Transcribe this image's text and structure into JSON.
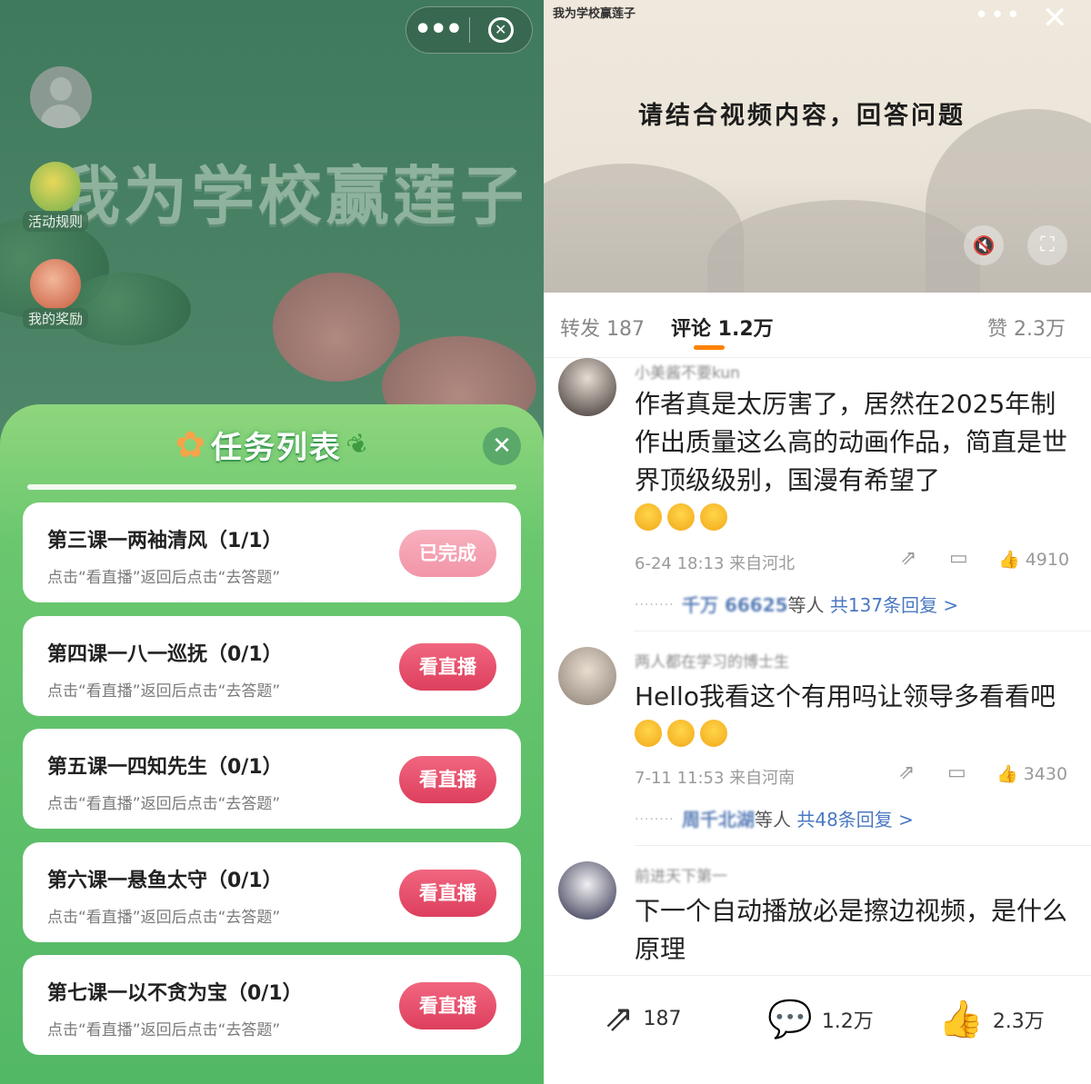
{
  "left": {
    "banner_title": "我为学校赢莲子",
    "side_buttons": [
      "活动规则",
      "我的奖励"
    ],
    "sheet": {
      "title": "任务列表",
      "tasks": [
        {
          "title": "第三课一两袖清风（1/1）",
          "hint": "点击“看直播”返回后点击“去答题”",
          "button": "已完成",
          "status": "done"
        },
        {
          "title": "第四课一八一巡抚（0/1）",
          "hint": "点击“看直播”返回后点击“去答题”",
          "button": "看直播",
          "status": "todo"
        },
        {
          "title": "第五课一四知先生（0/1）",
          "hint": "点击“看直播”返回后点击“去答题”",
          "button": "看直播",
          "status": "todo"
        },
        {
          "title": "第六课一悬鱼太守（0/1）",
          "hint": "点击“看直播”返回后点击“去答题”",
          "button": "看直播",
          "status": "todo"
        },
        {
          "title": "第七课一以不贪为宝（0/1）",
          "hint": "点击“看直播”返回后点击“去答题”",
          "button": "看直播",
          "status": "todo"
        }
      ]
    }
  },
  "right": {
    "video": {
      "logo": "我为学校赢莲子",
      "caption": "请结合视频内容，回答问题"
    },
    "tabs": {
      "forward": "转发 187",
      "comments": "评论 1.2万",
      "likes": "赞 2.3万"
    },
    "comments": [
      {
        "name": "小美酱不要kun",
        "text": "作者真是太厉害了，居然在2025年制作出质量这么高的动画作品，简直是世界顶级级别，国漫有希望了",
        "emoji_count": 3,
        "meta": "6-24 18:13 来自河北",
        "likes": "4910",
        "reply_users": "千万 66625",
        "reply_suffix": "等人",
        "reply_link": "共137条回复 >"
      },
      {
        "name": "两人都在学习的博士生",
        "text": "Hello我看这个有用吗让领导多看看吧",
        "emoji_count": 3,
        "meta": "7-11 11:53 来自河南",
        "likes": "3430",
        "reply_users": "周千北湖",
        "reply_suffix": "等人",
        "reply_link": "共48条回复 >"
      },
      {
        "name": "前进天下第一",
        "text": "下一个自动播放必是擦边视频，是什么原理"
      }
    ],
    "bottom_bar": {
      "share": "187",
      "comment": "1.2万",
      "like": "2.3万"
    }
  }
}
